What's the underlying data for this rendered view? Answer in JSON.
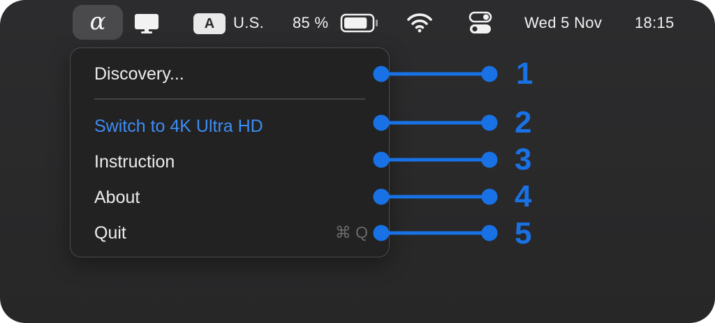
{
  "menubar": {
    "app_glyph": "α",
    "keyboard_badge": "A",
    "keyboard_layout": "U.S.",
    "battery_percent": "85 %",
    "battery_level": 0.85,
    "date": "Wed 5 Nov",
    "time": "18:15"
  },
  "menu": {
    "items": [
      {
        "label": "Discovery..."
      },
      {
        "label": "Switch to 4K Ultra HD",
        "color": "#3d8df4"
      },
      {
        "label": "Instruction"
      },
      {
        "label": "About"
      },
      {
        "label": "Quit",
        "shortcut": "⌘ Q"
      }
    ]
  },
  "callouts": {
    "color": "#1872e6",
    "numbers": [
      "1",
      "2",
      "3",
      "4",
      "5"
    ]
  },
  "icons": [
    "display-icon",
    "battery-icon",
    "wifi-icon",
    "control-center-icon"
  ]
}
